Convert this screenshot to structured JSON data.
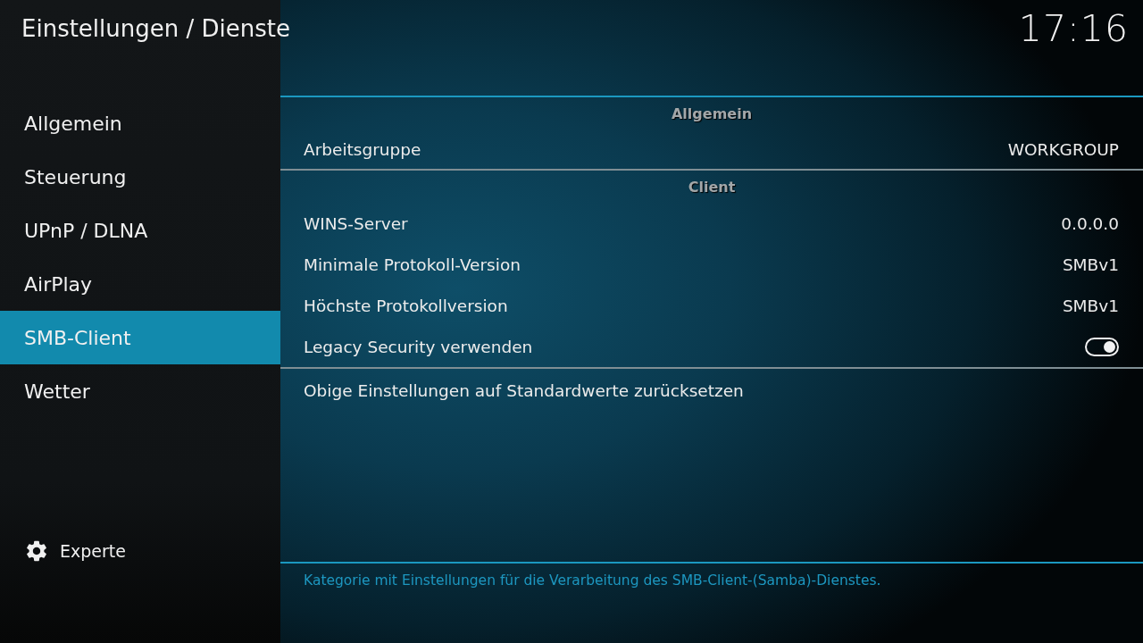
{
  "header": {
    "title": "Einstellungen / Dienste",
    "clock": "17:16"
  },
  "sidebar": {
    "items": [
      {
        "label": "Allgemein",
        "selected": false
      },
      {
        "label": "Steuerung",
        "selected": false
      },
      {
        "label": "UPnP / DLNA",
        "selected": false
      },
      {
        "label": "AirPlay",
        "selected": false
      },
      {
        "label": "SMB-Client",
        "selected": true
      },
      {
        "label": "Wetter",
        "selected": false
      }
    ],
    "level_button": {
      "label": "Experte"
    }
  },
  "settings": {
    "groups": [
      {
        "heading": "Allgemein",
        "rows": [
          {
            "kind": "value",
            "label": "Arbeitsgruppe",
            "value": "WORKGROUP"
          }
        ]
      },
      {
        "heading": "Client",
        "rows": [
          {
            "kind": "value",
            "label": "WINS-Server",
            "value": "0.0.0.0"
          },
          {
            "kind": "value",
            "label": "Minimale Protokoll-Version",
            "value": "SMBv1"
          },
          {
            "kind": "value",
            "label": "Höchste Protokollversion",
            "value": "SMBv1"
          },
          {
            "kind": "toggle",
            "label": "Legacy Security verwenden",
            "on": true
          }
        ]
      },
      {
        "rows": [
          {
            "kind": "action",
            "label": "Obige Einstellungen auf Standardwerte zurücksetzen"
          }
        ]
      }
    ]
  },
  "description": "Kategorie mit Einstellungen für die Verarbeitung des SMB-Client-(Samba)-Dienstes."
}
